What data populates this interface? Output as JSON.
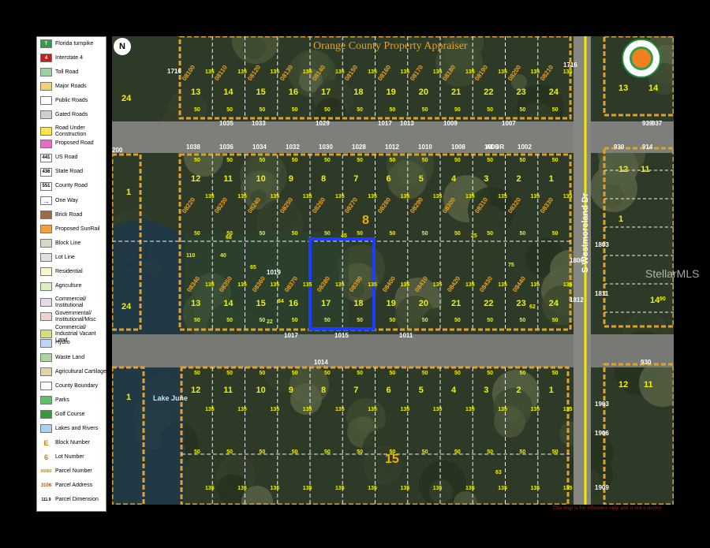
{
  "legend": {
    "items": [
      {
        "label": "Florida turnpike",
        "swatch": "#2e9e4a",
        "glyph": "T"
      },
      {
        "label": "Interstate 4",
        "swatch": "#c02020",
        "glyph": "4"
      },
      {
        "label": "Toll Road",
        "swatch": "#9bd0a0",
        "glyph": ""
      },
      {
        "label": "Major Roads",
        "swatch": "#f5d070",
        "glyph": ""
      },
      {
        "label": "Public Roads",
        "swatch": "#ffffff",
        "glyph": ""
      },
      {
        "label": "Gated Roads",
        "swatch": "#cfcfcf",
        "glyph": ""
      },
      {
        "label": "Road Under Construction",
        "swatch": "#ffe14a",
        "glyph": "!"
      },
      {
        "label": "Proposed Road",
        "swatch": "#e070c0",
        "glyph": ""
      },
      {
        "label": "US Road",
        "swatch": "#ffffff",
        "glyph": "441"
      },
      {
        "label": "State Road",
        "swatch": "#ffffff",
        "glyph": "436"
      },
      {
        "label": "County Road",
        "swatch": "#ffffff",
        "glyph": "551"
      },
      {
        "label": "One Way",
        "swatch": "#2030c0",
        "glyph": "→"
      },
      {
        "label": "Brick Road",
        "swatch": "#9a6a4a",
        "glyph": ""
      },
      {
        "label": "Proposed SunRail",
        "swatch": "#f0a040",
        "glyph": ""
      },
      {
        "label": "Block Line",
        "swatch": "#d8d8c8",
        "glyph": ""
      },
      {
        "label": "Lot Line",
        "swatch": "#e0e0e0",
        "glyph": ""
      },
      {
        "label": "Residential",
        "swatch": "#f6f6d2",
        "glyph": ""
      },
      {
        "label": "Agriculture",
        "swatch": "#d8f0c0",
        "glyph": ""
      },
      {
        "label": "Commercial/ Institutional",
        "swatch": "#e6d8f0",
        "glyph": ""
      },
      {
        "label": "Governmental/ Institutional/Misc",
        "swatch": "#f0d0d0",
        "glyph": ""
      },
      {
        "label": "Commercial/ Industrial Vacant Land",
        "swatch": "#d6e07a",
        "glyph": ""
      },
      {
        "label": "Hydro",
        "swatch": "#bcd4f6",
        "glyph": ""
      },
      {
        "label": "Waste Land",
        "swatch": "#a8d8a0",
        "glyph": ""
      },
      {
        "label": "Agricultural Cartilage",
        "swatch": "#e6d2a8",
        "glyph": ""
      },
      {
        "label": "County Boundary",
        "swatch": "#ffffff",
        "glyph": ""
      },
      {
        "label": "Parks",
        "swatch": "#5cc06a",
        "glyph": ""
      },
      {
        "label": "Golf Course",
        "swatch": "#3a9a3a",
        "glyph": ""
      },
      {
        "label": "Lakes and Rivers",
        "swatch": "#a8d0f0",
        "glyph": ""
      },
      {
        "label": "Block Number",
        "swatch": "#ffffff",
        "glyph": "E"
      },
      {
        "label": "Lot Number",
        "swatch": "#ffffff",
        "glyph": "6"
      },
      {
        "label": "Parcel Number",
        "swatch": "#ffffff",
        "glyph": "06060"
      },
      {
        "label": "Parcel Address",
        "swatch": "#ffffff",
        "glyph": "3106"
      },
      {
        "label": "Parcel Dimension",
        "swatch": "#ffffff",
        "glyph": "111.9"
      }
    ]
  },
  "map": {
    "title": "Orange County Property Appraiser",
    "north_label": "N",
    "street_name": "S Westmoreland Dr",
    "lake_name": "Lake June",
    "addr_tag": "ADDR",
    "watermark": "StellarMLS",
    "disclaimer": "This map is for reference only and is not a survey",
    "colors": {
      "highlight": "#1e3cff",
      "roads": "#f5c842",
      "block_line": "#e0a030",
      "lot_label": "#f0f000"
    },
    "block_numbers": [
      "8",
      "15"
    ],
    "row_a_lots": [
      "13",
      "14",
      "15",
      "16",
      "17",
      "18",
      "19",
      "20",
      "21",
      "22",
      "23",
      "24"
    ],
    "row_a_addresses": [
      "1035",
      "1033",
      "1029",
      "1017",
      "1013",
      "1009",
      "1007",
      "939",
      "937"
    ],
    "row_b_lots": [
      "12",
      "11",
      "10",
      "9",
      "8",
      "7",
      "6",
      "5",
      "4",
      "3",
      "2",
      "1"
    ],
    "row_b_addresses": [
      "1038",
      "1036",
      "1034",
      "1032",
      "1030",
      "1028",
      "1012",
      "1010",
      "1008",
      "1006",
      "1002",
      "930",
      "914"
    ],
    "row_c_lots": [
      "13",
      "14",
      "15",
      "16",
      "17",
      "18",
      "19",
      "20",
      "21",
      "22",
      "23",
      "24"
    ],
    "row_c_addresses": [
      "1017",
      "1015",
      "1011"
    ],
    "row_d_lots": [
      "12",
      "11",
      "10",
      "9",
      "8",
      "7",
      "6",
      "5",
      "4",
      "3",
      "2",
      "1"
    ],
    "row_d_addresses": [
      "1014",
      "930"
    ],
    "left_lots": [
      "24",
      "1",
      "24",
      "1"
    ],
    "right_lots": [
      "13",
      "14",
      "12",
      "11",
      "1",
      "14",
      "12",
      "11"
    ],
    "side_addresses": [
      "1716",
      "1716",
      "200",
      "1806",
      "1812",
      "1803",
      "1811",
      "1903",
      "1906",
      "1909",
      "1019"
    ],
    "dimensions": [
      "50",
      "135",
      "45",
      "25",
      "40",
      "22",
      "110",
      "65",
      "75",
      "68",
      "90",
      "63",
      "62",
      "84"
    ],
    "parcels": [
      "08100",
      "08110",
      "08120",
      "08130",
      "08140",
      "08150",
      "08160",
      "08170",
      "08180",
      "08190",
      "08200",
      "08210",
      "08220",
      "08230",
      "08240",
      "08250",
      "08260",
      "08270",
      "08280",
      "08290",
      "08300",
      "08310",
      "08320",
      "08330",
      "08340",
      "08350",
      "08360",
      "08370",
      "08380",
      "08390",
      "08400",
      "08410",
      "08420",
      "08430",
      "08440"
    ]
  }
}
